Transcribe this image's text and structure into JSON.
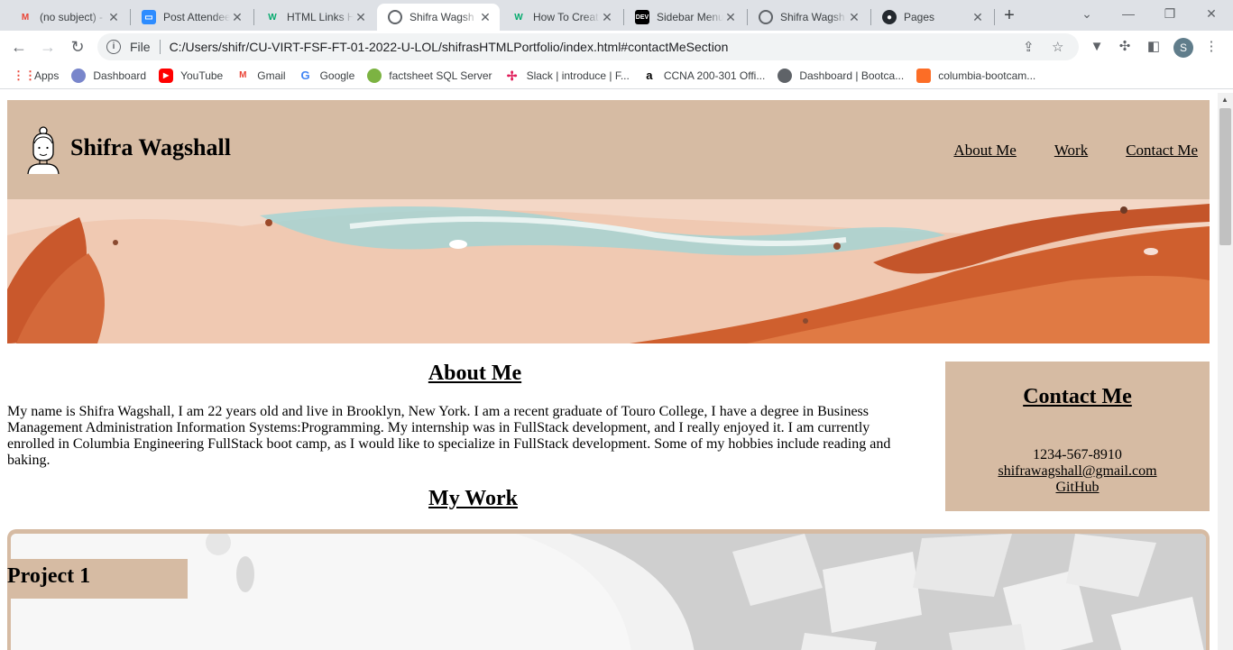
{
  "browser": {
    "tabs": [
      {
        "title": "(no subject) -",
        "icon": "gmail-icon",
        "active": false
      },
      {
        "title": "Post Attendee",
        "icon": "zoom-icon",
        "active": false
      },
      {
        "title": "HTML Links H",
        "icon": "w3schools-icon",
        "active": false
      },
      {
        "title": "Shifra Wagsh",
        "icon": "globe-icon",
        "active": true
      },
      {
        "title": "How To Creat",
        "icon": "w3schools-icon",
        "active": false
      },
      {
        "title": "Sidebar Menu",
        "icon": "dev-icon",
        "active": false
      },
      {
        "title": "Shifra Wagsh",
        "icon": "globe-icon",
        "active": false
      },
      {
        "title": "Pages",
        "icon": "github-icon",
        "active": false
      }
    ],
    "address": {
      "scheme_label": "File",
      "url": "C:/Users/shifr/CU-VIRT-FSF-FT-01-2022-U-LOL/shifrasHTMLPortfolio/index.html#contactMeSection"
    },
    "profile_initial": "S",
    "bookmarks": [
      {
        "label": "Apps",
        "icon": "apps-grid-icon",
        "color": "#ea4335"
      },
      {
        "label": "Dashboard",
        "icon": "dashboard-icon",
        "color": "#7986cb"
      },
      {
        "label": "YouTube",
        "icon": "youtube-icon",
        "color": "#ff0000"
      },
      {
        "label": "Gmail",
        "icon": "gmail-icon",
        "color": "#ea4335"
      },
      {
        "label": "Google",
        "icon": "google-icon",
        "color": "#4285f4"
      },
      {
        "label": "factsheet SQL Server",
        "icon": "leaf-icon",
        "color": "#7cb342"
      },
      {
        "label": "Slack | introduce | F...",
        "icon": "slack-icon",
        "color": "#e01e5a"
      },
      {
        "label": "CCNA 200-301 Offi...",
        "icon": "amazon-icon",
        "color": "#ff9900"
      },
      {
        "label": "Dashboard | Bootca...",
        "icon": "globe-icon",
        "color": "#5f6368"
      },
      {
        "label": "columbia-bootcam...",
        "icon": "gitlab-icon",
        "color": "#fc6d26"
      }
    ]
  },
  "site": {
    "name": "Shifra Wagshall",
    "nav": [
      "About Me",
      "Work",
      "Contact Me"
    ],
    "about": {
      "heading": "About Me",
      "body": "My name is Shifra Wagshall, I am 22 years old and live in Brooklyn, New York. I am a recent graduate of Touro College, I have a degree in Business Management Administration Information Systems:Programming. My internship was in FullStack development, and I really enjoyed it. I am currently enrolled in Columbia Engineering FullStack boot camp, as I would like to specialize in FullStack development. Some of my hobbies include reading and baking."
    },
    "work": {
      "heading": "My Work",
      "projects": [
        {
          "label": "Project 1"
        }
      ]
    },
    "contact": {
      "heading": "Contact Me",
      "phone": "1234-567-8910",
      "email": "shifrawagshall@gmail.com",
      "github": "GitHub"
    },
    "colors": {
      "accent": "#d6bba3"
    }
  }
}
